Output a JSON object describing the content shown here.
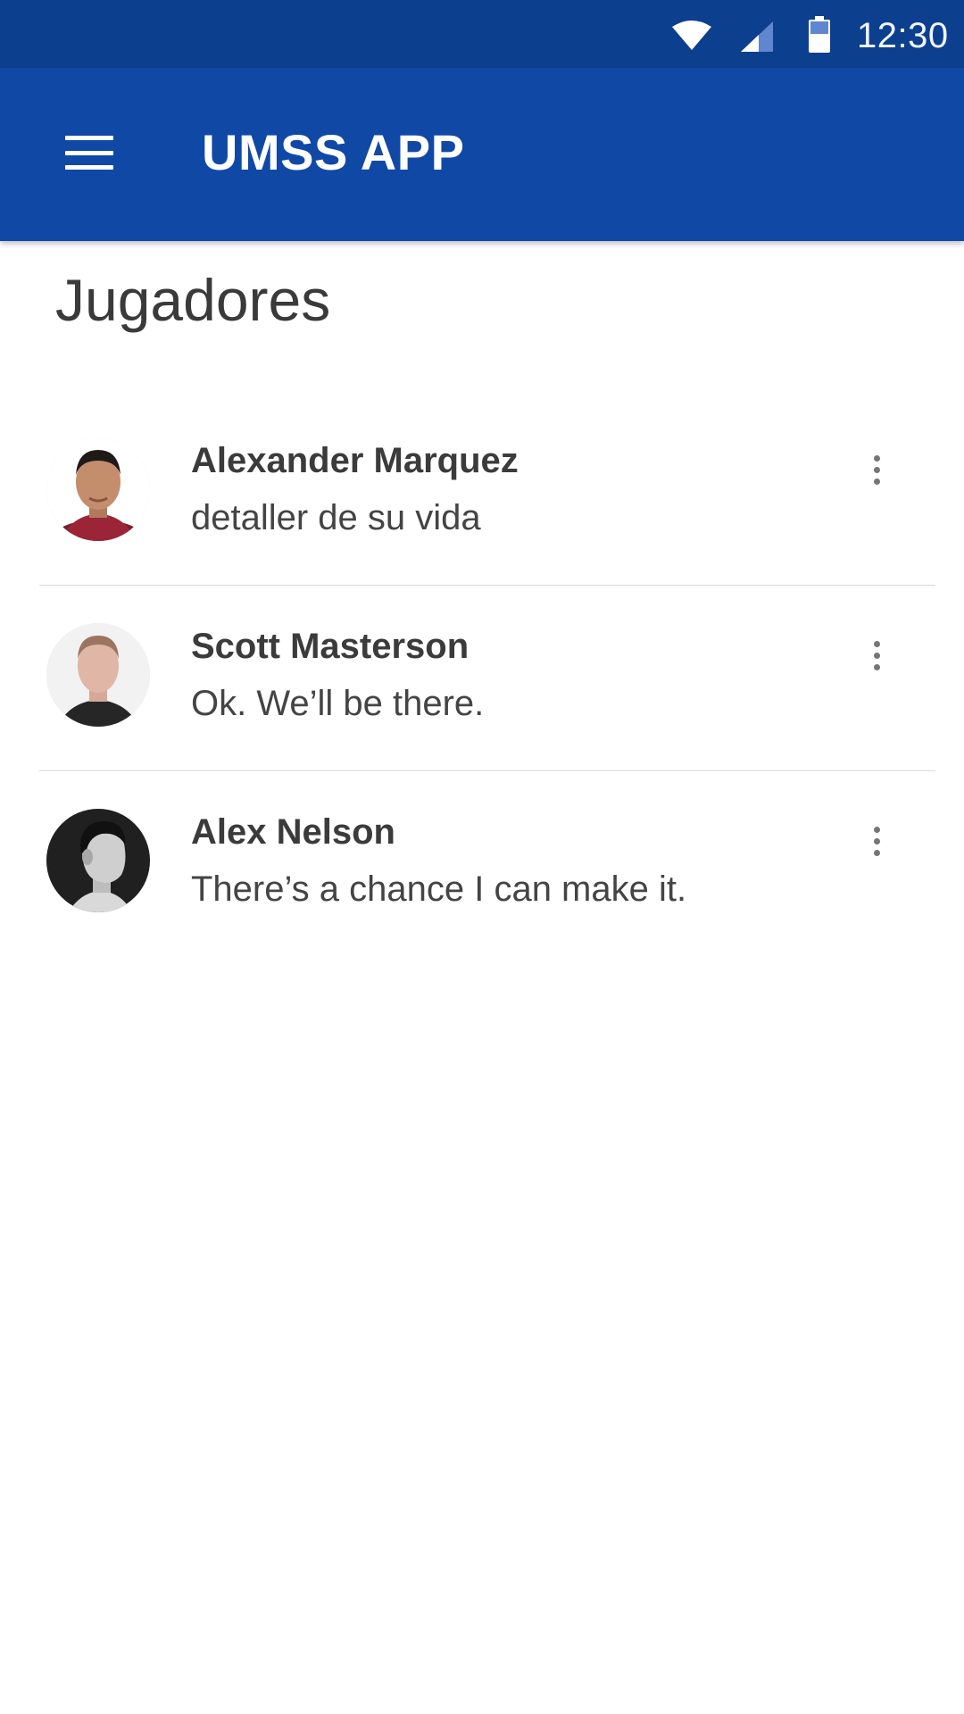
{
  "status_bar": {
    "time": "12:30",
    "icons": [
      "wifi-icon",
      "signal-icon",
      "battery-icon"
    ],
    "color": "#0d3f8f"
  },
  "app_bar": {
    "title": "UMSS APP",
    "menu_icon": "menu-icon",
    "color": "#1048a6"
  },
  "page": {
    "title": "Jugadores"
  },
  "players": [
    {
      "name": "Alexander Marquez",
      "message": "detaller de su vida",
      "avatar": "avatar-photo",
      "more_icon": "more-vert-icon"
    },
    {
      "name": "Scott Masterson",
      "message": "Ok. We’ll be there.",
      "avatar": "avatar-photo",
      "more_icon": "more-vert-icon"
    },
    {
      "name": "Alex Nelson",
      "message": "There’s a chance I can make it.",
      "avatar": "avatar-photo",
      "more_icon": "more-vert-icon"
    }
  ]
}
